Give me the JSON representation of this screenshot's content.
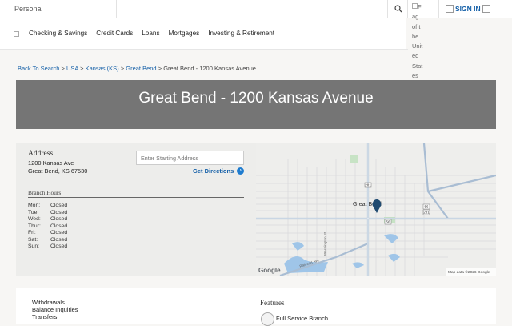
{
  "topbar": {
    "personal_label": "Personal",
    "flag_alt": "Flag of the United States of America",
    "signin_label": "SIGN IN"
  },
  "nav": {
    "items": [
      {
        "label": "Checking & Savings"
      },
      {
        "label": "Credit Cards"
      },
      {
        "label": "Loans"
      },
      {
        "label": "Mortgages"
      },
      {
        "label": "Investing & Retirement"
      }
    ]
  },
  "breadcrumb": {
    "back": "Back To Search",
    "country": "USA",
    "state": "Kansas (KS)",
    "city": "Great Bend",
    "current": "Great Bend - 1200 Kansas Avenue",
    "separator": ">"
  },
  "hero": {
    "title": "Great Bend - 1200 Kansas Avenue"
  },
  "branch": {
    "address_title": "Address",
    "street": "1200 Kansas Ave",
    "city_line": "Great Bend, KS 67530",
    "start_placeholder": "Enter Starting Address",
    "directions_label": "Get Directions",
    "hours_title": "Branch Hours",
    "hours": [
      {
        "day": "Mon:",
        "value": "Closed"
      },
      {
        "day": "Tue:",
        "value": "Closed"
      },
      {
        "day": "Wed:",
        "value": "Closed"
      },
      {
        "day": "Thur:",
        "value": "Closed"
      },
      {
        "day": "Fri:",
        "value": "Closed"
      },
      {
        "day": "Sat:",
        "value": "Closed"
      },
      {
        "day": "Sun:",
        "value": "Closed"
      }
    ]
  },
  "map": {
    "city_label": "Great Bend",
    "street_label_1": "Washington St",
    "street_label_2": "Railroad Ave",
    "route_1": "281",
    "route_2": "56",
    "route_3": "281",
    "route_4": "56",
    "brand": "Google",
    "credit": "Map data ©2026 Google"
  },
  "services": {
    "items": [
      "Withdrawals",
      "Balance Inquiries",
      "Transfers"
    ]
  },
  "features": {
    "title": "Features",
    "items": [
      "Full Service Branch"
    ]
  },
  "colors": {
    "link": "#1560a8",
    "hero_bg": "#757575",
    "card_bg": "#ededeb",
    "marker": "#1f4a70"
  }
}
